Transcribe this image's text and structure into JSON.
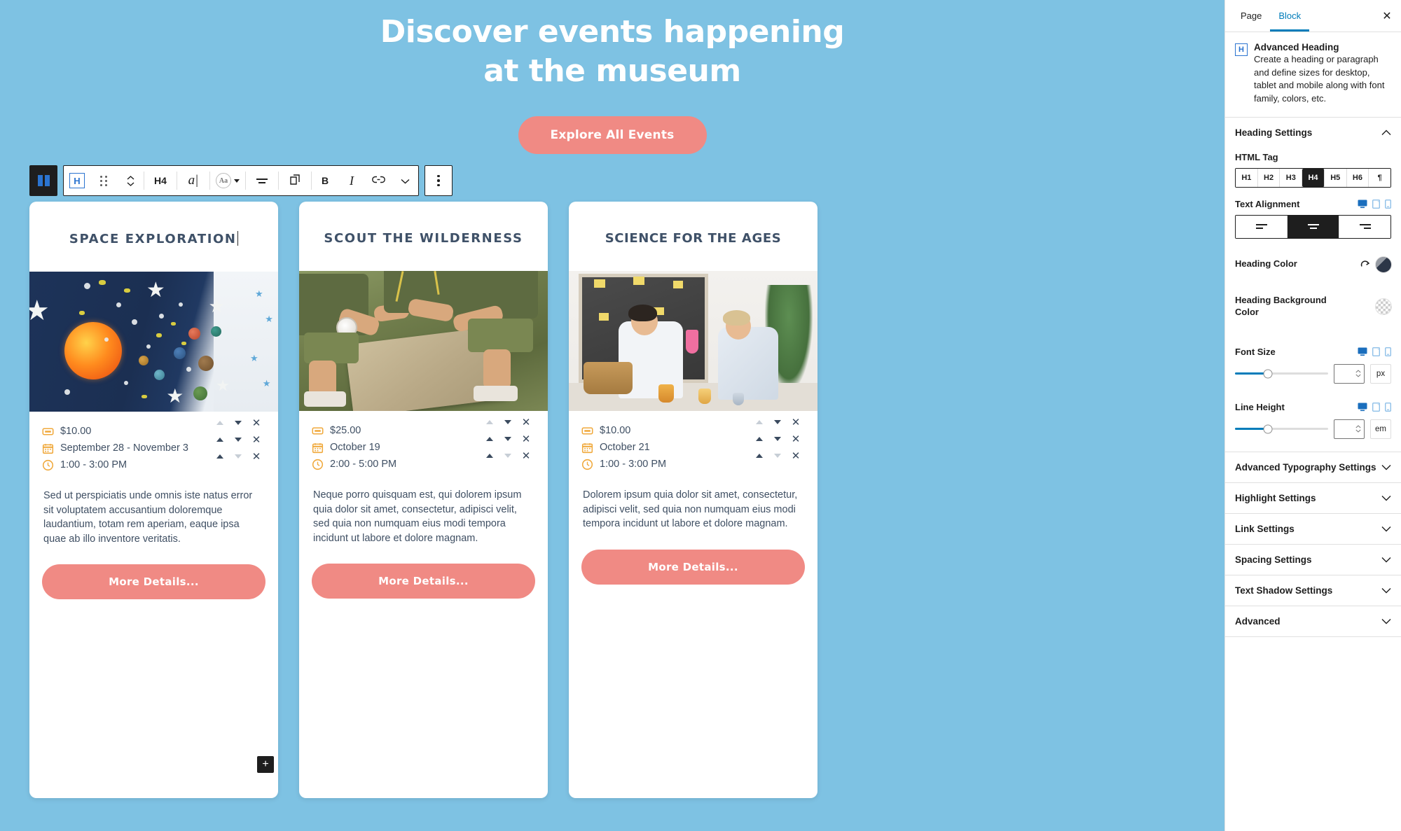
{
  "theme": {
    "canvas_bg": "#7ec2e3",
    "accent_coral": "#f08a84",
    "heading_navy": "#3f5168",
    "icon_orange": "#f0a93c",
    "editor_blue": "#007cba"
  },
  "hero": {
    "title_line1": "Discover events happening",
    "title_line2": "at the museum",
    "cta_label": "Explore All Events"
  },
  "block_toolbar": {
    "columns_icon": "columns-icon",
    "block_type_icon": "heading-block-icon",
    "drag_icon": "drag-handle-icon",
    "move_icon": "move-up-down-icon",
    "tag_label": "H4",
    "text_cursor_icon": "text-cursor-icon",
    "font_label": "Aa",
    "align_icon": "align-center-icon",
    "duplicate_icon": "duplicate-icon",
    "bold_label": "B",
    "italic_label": "I",
    "link_icon": "link-icon",
    "more_formats_icon": "chevron-down-icon",
    "options_icon": "kebab-menu-icon"
  },
  "cards": [
    {
      "title": "SPACE EXPLORATION",
      "editing": true,
      "image_alt": "solar-system-craft-board",
      "meta": [
        {
          "icon": "ticket-icon",
          "text": "$10.00",
          "up_enabled": false,
          "down_enabled": true
        },
        {
          "icon": "calendar-icon",
          "text": "September 28 - November 3",
          "up_enabled": true,
          "down_enabled": true
        },
        {
          "icon": "clock-icon",
          "text": "1:00 - 3:00 PM",
          "up_enabled": true,
          "down_enabled": false
        }
      ],
      "body": "Sed ut perspiciatis unde omnis iste natus error sit voluptatem accusantium doloremque laudantium, totam rem aperiam, eaque ipsa quae ab illo inventore veritatis.",
      "cta_label": "More Details...",
      "has_add_block": true,
      "add_block_label": "+"
    },
    {
      "title": "SCOUT THE WILDERNESS",
      "editing": false,
      "image_alt": "scouts-reading-map",
      "meta": [
        {
          "icon": "ticket-icon",
          "text": "$25.00",
          "up_enabled": false,
          "down_enabled": true
        },
        {
          "icon": "calendar-icon",
          "text": "October 19",
          "up_enabled": true,
          "down_enabled": true
        },
        {
          "icon": "clock-icon",
          "text": "2:00 - 5:00 PM",
          "up_enabled": true,
          "down_enabled": false
        }
      ],
      "body": "Neque porro quisquam est, qui dolorem ipsum quia dolor sit amet, consectetur, adipisci velit, sed quia non numquam eius modi tempora incidunt ut labore et dolore magnam.",
      "cta_label": "More Details...",
      "has_add_block": false,
      "add_block_label": "+"
    },
    {
      "title": "SCIENCE FOR THE AGES",
      "editing": false,
      "image_alt": "children-science-experiment",
      "meta": [
        {
          "icon": "ticket-icon",
          "text": "$10.00",
          "up_enabled": false,
          "down_enabled": true
        },
        {
          "icon": "calendar-icon",
          "text": "October 21",
          "up_enabled": true,
          "down_enabled": true
        },
        {
          "icon": "clock-icon",
          "text": "1:00 - 3:00 PM",
          "up_enabled": true,
          "down_enabled": false
        }
      ],
      "body": "Dolorem ipsum quia dolor sit amet, consectetur, adipisci velit, sed quia non numquam eius modi tempora incidunt ut labore et dolore magnam.",
      "cta_label": "More Details...",
      "has_add_block": false,
      "add_block_label": "+"
    }
  ],
  "sidebar": {
    "tabs": [
      {
        "label": "Page",
        "active": false
      },
      {
        "label": "Block",
        "active": true
      }
    ],
    "close_label": "✕",
    "block": {
      "icon_letter": "H",
      "name": "Advanced Heading",
      "description": "Create a heading or paragraph and define sizes for desktop, tablet and mobile along with font family, colors, etc."
    },
    "heading_settings": {
      "title": "Heading Settings",
      "expanded": true,
      "html_tag": {
        "label": "HTML Tag",
        "options": [
          "H1",
          "H2",
          "H3",
          "H4",
          "H5",
          "H6",
          "¶"
        ],
        "selected": "H4"
      },
      "text_alignment": {
        "label": "Text Alignment",
        "options": [
          "left",
          "center",
          "right"
        ],
        "selected": "center",
        "devices": [
          "desktop",
          "tablet",
          "mobile"
        ],
        "active_device": "desktop"
      },
      "heading_color": {
        "label": "Heading Color",
        "reset_icon": "reset-arrow-icon",
        "swatch": "#2c3647"
      },
      "heading_bg_color": {
        "label": "Heading Background Color",
        "swatch": "transparent"
      },
      "font_size": {
        "label": "Font Size",
        "value": "",
        "unit": "px",
        "slider_percent": 35,
        "devices": [
          "desktop",
          "tablet",
          "mobile"
        ],
        "active_device": "desktop"
      },
      "line_height": {
        "label": "Line Height",
        "value": "",
        "unit": "em",
        "slider_percent": 35,
        "devices": [
          "desktop",
          "tablet",
          "mobile"
        ],
        "active_device": "desktop"
      }
    },
    "sections": [
      {
        "title": "Advanced Typography Settings",
        "expanded": false
      },
      {
        "title": "Highlight Settings",
        "expanded": false
      },
      {
        "title": "Link Settings",
        "expanded": false
      },
      {
        "title": "Spacing Settings",
        "expanded": false
      },
      {
        "title": "Text Shadow Settings",
        "expanded": false
      },
      {
        "title": "Advanced",
        "expanded": false
      }
    ]
  }
}
